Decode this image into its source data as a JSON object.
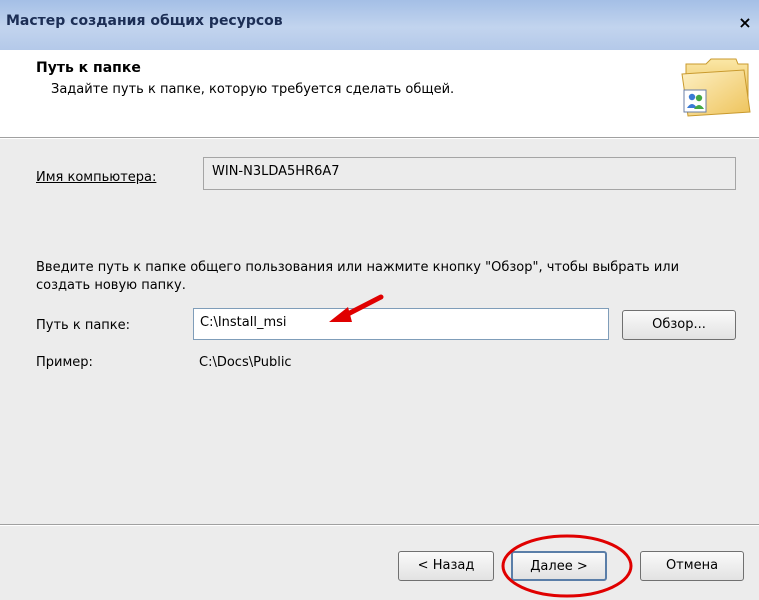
{
  "window": {
    "title": "Мастер создания общих ресурсов",
    "close_glyph": "×"
  },
  "header": {
    "heading": "Путь к папке",
    "subheading": "Задайте путь к папке, которую требуется сделать общей.",
    "icon": "shared-folder-icon"
  },
  "form": {
    "computer_label": "Имя компьютера:",
    "computer_value": "WIN-N3LDA5HR6A7",
    "instructions": "Введите путь к папке общего пользования или нажмите кнопку \"Обзор\", чтобы выбрать или создать новую папку.",
    "path_label": "Путь к папке:",
    "path_value": "C:\\Install_msi",
    "browse_label": "Обзор...",
    "example_label": "Пример:",
    "example_value": "C:\\Docs\\Public"
  },
  "buttons": {
    "back": "< Назад",
    "next": "Далее >",
    "cancel": "Отмена"
  },
  "annotations": {
    "color": "#e00000"
  }
}
